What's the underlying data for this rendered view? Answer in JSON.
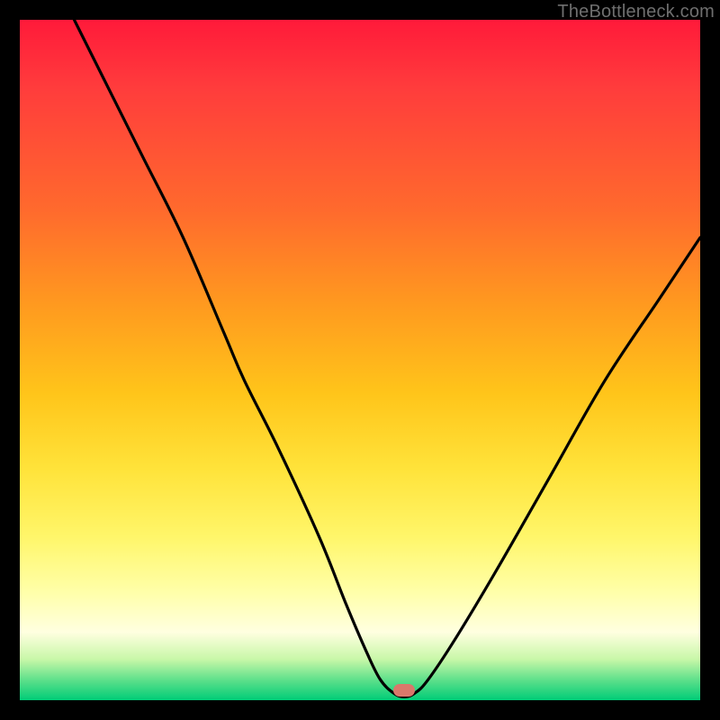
{
  "watermark": "TheBottleneck.com",
  "colors": {
    "frame": "#000000",
    "gradient_top": "#ff1a3a",
    "gradient_mid1": "#ff9a1f",
    "gradient_mid2": "#ffe33a",
    "gradient_low": "#ffffe0",
    "gradient_bottom": "#00cc77",
    "curve": "#000000",
    "marker": "#d9786b",
    "watermark_text": "#6f6f6f"
  },
  "chart_data": {
    "type": "line",
    "title": "",
    "xlabel": "",
    "ylabel": "",
    "xlim": [
      0,
      100
    ],
    "ylim": [
      0,
      100
    ],
    "series": [
      {
        "name": "bottleneck-curve",
        "x": [
          8,
          12,
          18,
          24,
          30,
          33,
          38,
          44,
          48,
          51,
          53,
          55,
          56.5,
          58,
          60,
          64,
          70,
          78,
          86,
          94,
          100
        ],
        "y": [
          100,
          92,
          80,
          68,
          54,
          47,
          37,
          24,
          14,
          7,
          3,
          1,
          0.5,
          1,
          3,
          9,
          19,
          33,
          47,
          59,
          68
        ]
      }
    ],
    "annotations": [
      {
        "name": "min-marker",
        "x": 56.5,
        "y": 1.5,
        "shape": "rounded-rect",
        "color": "#d9786b"
      }
    ],
    "grid": false,
    "legend": false
  }
}
